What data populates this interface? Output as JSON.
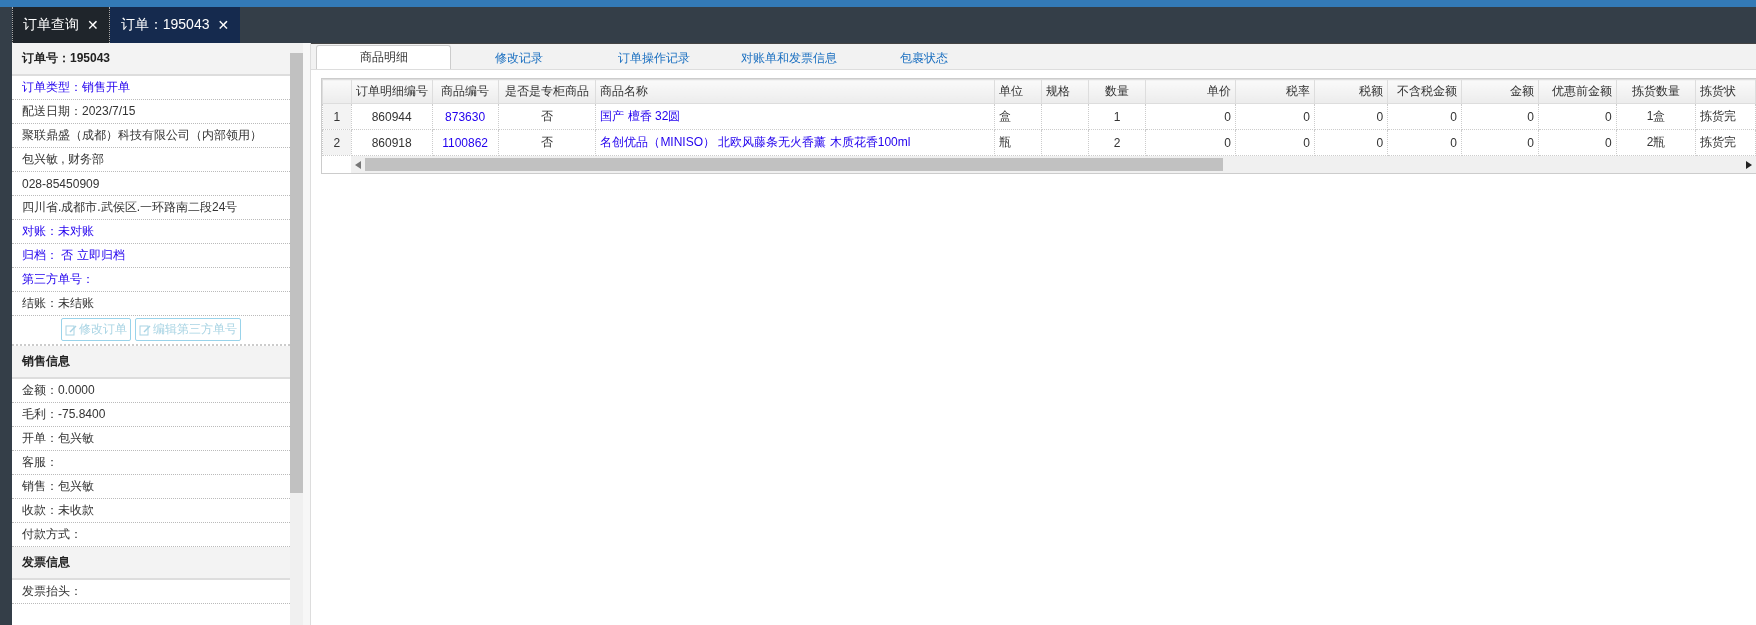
{
  "tabs": [
    {
      "label": "订单查询",
      "selected": false,
      "close": "✕"
    },
    {
      "label": "订单：195043",
      "selected": true,
      "close": "✕"
    }
  ],
  "order_panel": {
    "title": "订单号：195043",
    "rows": [
      {
        "text": "订单类型：销售开单",
        "kind": "link"
      },
      {
        "text": "配送日期：2023/7/15",
        "kind": "text"
      },
      {
        "text": "聚联鼎盛（成都）科技有限公司（内部领用）",
        "kind": "text"
      },
      {
        "text": "包兴敏 , 财务部",
        "kind": "text"
      },
      {
        "text": "028-85450909",
        "kind": "text"
      },
      {
        "text": "四川省.成都市.武侯区.一环路南二段24号",
        "kind": "text"
      },
      {
        "text": "对账：未对账",
        "kind": "link"
      },
      {
        "text": "归档： 否 立即归档",
        "kind": "link"
      },
      {
        "text": "第三方单号：",
        "kind": "link"
      },
      {
        "text": "结账：未结账",
        "kind": "text"
      }
    ],
    "buttons": [
      {
        "label": "修改订单",
        "disabled": true
      },
      {
        "label": "编辑第三方单号",
        "disabled": true
      }
    ],
    "sections": [
      {
        "title": "销售信息",
        "rows": [
          "金额：0.0000",
          "毛利：-75.8400",
          "开单：包兴敏",
          "客服：",
          "销售：包兴敏",
          "收款：未收款",
          "付款方式："
        ]
      },
      {
        "title": "发票信息",
        "rows": [
          "发票抬头："
        ]
      }
    ]
  },
  "detail_tabs": [
    {
      "label": "商品明细",
      "selected": true
    },
    {
      "label": "修改记录",
      "selected": false
    },
    {
      "label": "订单操作记录",
      "selected": false
    },
    {
      "label": "对账单和发票信息",
      "selected": false
    },
    {
      "label": "包裹状态",
      "selected": false
    }
  ],
  "table": {
    "columns": [
      {
        "label": "订单明细编号",
        "kind": "center"
      },
      {
        "label": "商品编号",
        "kind": "link-center"
      },
      {
        "label": "是否是专柜商品",
        "kind": "center"
      },
      {
        "label": "商品名称",
        "kind": "link"
      },
      {
        "label": "单位",
        "kind": "text"
      },
      {
        "label": "规格",
        "kind": "text"
      },
      {
        "label": "数量",
        "kind": "center"
      },
      {
        "label": "单价",
        "kind": "number"
      },
      {
        "label": "税率",
        "kind": "number"
      },
      {
        "label": "税额",
        "kind": "number"
      },
      {
        "label": "不含税金额",
        "kind": "number"
      },
      {
        "label": "金额",
        "kind": "number"
      },
      {
        "label": "优惠前金额",
        "kind": "number"
      },
      {
        "label": "拣货数量",
        "kind": "center"
      },
      {
        "label": "拣货状",
        "kind": "text"
      }
    ],
    "rows": [
      {
        "index": "1",
        "cells": [
          "860944",
          "873630",
          "否",
          "国产 檀香 32圆",
          "盒",
          "",
          "1",
          "0",
          "0",
          "0",
          "0",
          "0",
          "0",
          "1盒",
          "拣货完"
        ]
      },
      {
        "index": "2",
        "cells": [
          "860918",
          "1100862",
          "否",
          "名创优品（MINISO） 北欧风藤条无火香薰 木质花香100ml",
          "瓶",
          "",
          "2",
          "0",
          "0",
          "0",
          "0",
          "0",
          "0",
          "2瓶",
          "拣货完"
        ]
      }
    ]
  }
}
